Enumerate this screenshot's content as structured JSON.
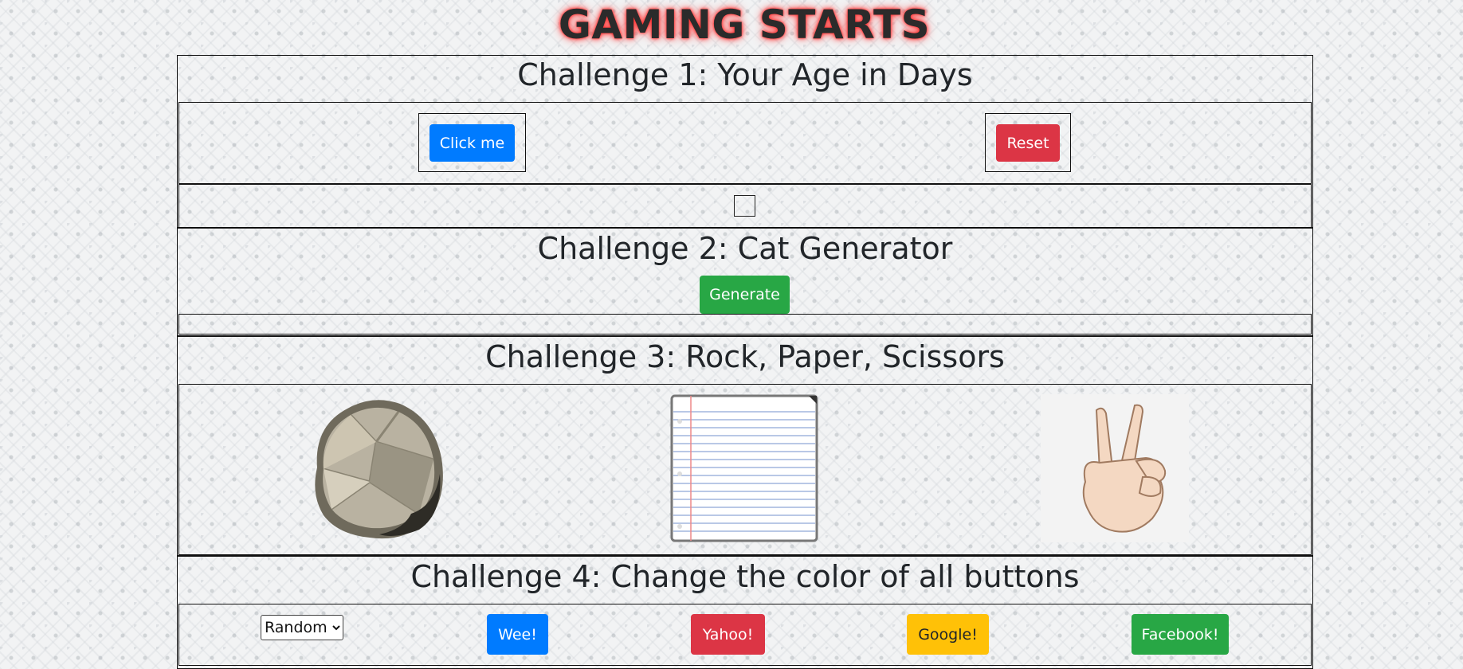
{
  "page": {
    "title": "GAMING STARTS"
  },
  "challenge1": {
    "heading": "Challenge 1: Your Age in Days",
    "click_label": "Click me",
    "reset_label": "Reset"
  },
  "challenge2": {
    "heading": "Challenge 2: Cat Generator",
    "generate_label": "Generate"
  },
  "challenge3": {
    "heading": "Challenge 3: Rock, Paper, Scissors",
    "choices": [
      "rock-image",
      "paper-image",
      "scissors-image"
    ]
  },
  "challenge4": {
    "heading": "Challenge 4: Change the color of all buttons",
    "select_value": "Random",
    "buttons": [
      "Wee!",
      "Yahoo!",
      "Google!",
      "Facebook!"
    ]
  },
  "colors": {
    "primary": "#007bff",
    "danger": "#dc3545",
    "success": "#28a745",
    "warning": "#ffc107",
    "title_glow": "#ff2a2a"
  }
}
